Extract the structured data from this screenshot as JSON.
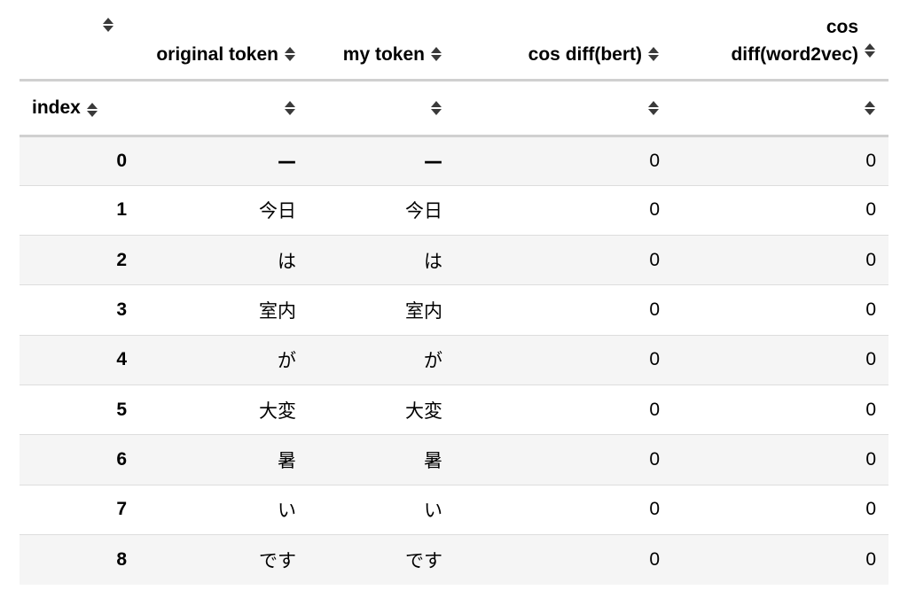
{
  "table": {
    "columns": [
      {
        "key": "blank",
        "label": ""
      },
      {
        "key": "original_token",
        "label": "original token"
      },
      {
        "key": "my_token",
        "label": "my token"
      },
      {
        "key": "cos_diff_bert",
        "label": "cos diff(bert)"
      },
      {
        "key": "cos_diff_word2vec",
        "label_line1": "cos",
        "label_line2": "diff(word2vec)"
      }
    ],
    "index_label": "index",
    "sort_icon": "sort-updown-icon",
    "rows": [
      {
        "index": "0",
        "original_token": "—",
        "my_token": "—",
        "cos_bert": "0",
        "cos_w2v": "0"
      },
      {
        "index": "1",
        "original_token": "今日",
        "my_token": "今日",
        "cos_bert": "0",
        "cos_w2v": "0"
      },
      {
        "index": "2",
        "original_token": "は",
        "my_token": "は",
        "cos_bert": "0",
        "cos_w2v": "0"
      },
      {
        "index": "3",
        "original_token": "室内",
        "my_token": "室内",
        "cos_bert": "0",
        "cos_w2v": "0"
      },
      {
        "index": "4",
        "original_token": "が",
        "my_token": "が",
        "cos_bert": "0",
        "cos_w2v": "0"
      },
      {
        "index": "5",
        "original_token": "大変",
        "my_token": "大変",
        "cos_bert": "0",
        "cos_w2v": "0"
      },
      {
        "index": "6",
        "original_token": "暑",
        "my_token": "暑",
        "cos_bert": "0",
        "cos_w2v": "0"
      },
      {
        "index": "7",
        "original_token": "い",
        "my_token": "い",
        "cos_bert": "0",
        "cos_w2v": "0"
      },
      {
        "index": "8",
        "original_token": "です",
        "my_token": "です",
        "cos_bert": "0",
        "cos_w2v": "0"
      }
    ],
    "colors": {
      "stripe": "#f5f5f5",
      "header_border": "#d0d0d0",
      "row_border": "#dddddd",
      "icon": "#3a3a3a"
    }
  }
}
